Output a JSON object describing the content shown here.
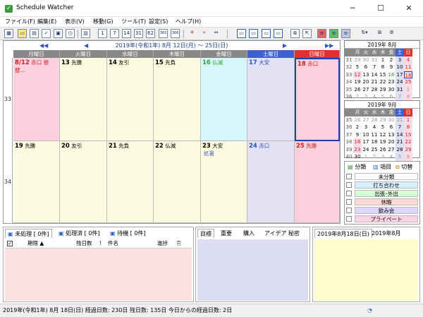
{
  "window": {
    "title": "Schedule Watcher",
    "minimize": "─",
    "maximize": "☐",
    "close": "✕"
  },
  "menu": [
    "ファイル(F)",
    "編集(E)",
    "表示(V)",
    "移動(G)",
    "ツール(T)",
    "設定(S)",
    "ヘルプ(H)"
  ],
  "toolbar": {
    "icons": [
      "grid-icon",
      "folder-icon",
      "note-icon",
      "check-icon",
      "screen-icon",
      "clock-icon",
      "day-1-icon",
      "week-7-icon",
      "twoweek-14-icon",
      "month-31-icon",
      "twomonth-62-icon",
      "year-365-icon",
      "year-366-icon",
      "split-icon",
      "split2-icon",
      "move-icon",
      "layout1-icon",
      "layout2-icon",
      "layout3-icon",
      "layout4-icon",
      "export-icon",
      "import-icon",
      "color-icon",
      "color2-icon",
      "color3-icon",
      "sort-icon",
      "config-icon",
      "gear-icon"
    ],
    "labels": [
      "1",
      "7",
      "14",
      "31",
      "62",
      "365",
      "366"
    ]
  },
  "calendar": {
    "range": "2019年(令和1年) 8月 12日(月) ～ 25日(日)",
    "days": [
      "月曜日",
      "火曜日",
      "水曜日",
      "木曜日",
      "金曜日",
      "土曜日",
      "日曜日"
    ],
    "weeks": [
      {
        "no": "33",
        "cells": [
          {
            "date": "8/12",
            "label": "赤口 振替...",
            "note": ""
          },
          {
            "date": "13",
            "label": "先勝",
            "note": ""
          },
          {
            "date": "14",
            "label": "友引",
            "note": ""
          },
          {
            "date": "15",
            "label": "先負",
            "note": ""
          },
          {
            "date": "16",
            "label": "仏滅",
            "note": ""
          },
          {
            "date": "17",
            "label": "大安",
            "note": ""
          },
          {
            "date": "18",
            "label": "赤口",
            "note": ""
          }
        ]
      },
      {
        "no": "34",
        "cells": [
          {
            "date": "19",
            "label": "先勝",
            "note": ""
          },
          {
            "date": "20",
            "label": "友引",
            "note": ""
          },
          {
            "date": "21",
            "label": "先負",
            "note": ""
          },
          {
            "date": "22",
            "label": "仏滅",
            "note": ""
          },
          {
            "date": "23",
            "label": "大安",
            "note": "処暑"
          },
          {
            "date": "24",
            "label": "赤口",
            "note": ""
          },
          {
            "date": "25",
            "label": "先勝",
            "note": ""
          }
        ]
      }
    ]
  },
  "mini_aug": {
    "title": "2019年 8月",
    "head": [
      "",
      "月",
      "火",
      "水",
      "木",
      "金",
      "土",
      "日"
    ],
    "rows": [
      [
        "31",
        "29",
        "30",
        "31",
        "1",
        "2",
        "3",
        "4"
      ],
      [
        "32",
        "5",
        "6",
        "7",
        "8",
        "9",
        "10",
        "11"
      ],
      [
        "33",
        "12",
        "13",
        "14",
        "15",
        "16",
        "17",
        "18"
      ],
      [
        "34",
        "19",
        "20",
        "21",
        "22",
        "23",
        "24",
        "25"
      ],
      [
        "35",
        "26",
        "27",
        "28",
        "29",
        "30",
        "31",
        "1"
      ],
      [
        "36",
        "2",
        "3",
        "4",
        "5",
        "6",
        "7",
        "8"
      ]
    ]
  },
  "mini_sep": {
    "title": "2019年 9月",
    "head": [
      "",
      "月",
      "火",
      "水",
      "木",
      "金",
      "土",
      "日"
    ],
    "rows": [
      [
        "35",
        "26",
        "27",
        "28",
        "29",
        "30",
        "31",
        "1"
      ],
      [
        "36",
        "2",
        "3",
        "4",
        "5",
        "6",
        "7",
        "8"
      ],
      [
        "37",
        "9",
        "10",
        "11",
        "12",
        "13",
        "14",
        "15"
      ],
      [
        "38",
        "16",
        "17",
        "18",
        "19",
        "20",
        "21",
        "22"
      ],
      [
        "39",
        "23",
        "24",
        "25",
        "26",
        "27",
        "28",
        "29"
      ],
      [
        "40",
        "30",
        "1",
        "2",
        "3",
        "4",
        "5",
        "6"
      ]
    ]
  },
  "categories": {
    "tabs": [
      "分類",
      "項目",
      "切替"
    ],
    "items": [
      {
        "label": "未分類",
        "color": "#ffffff"
      },
      {
        "label": "打ち合わせ",
        "color": "#d8f0ff"
      },
      {
        "label": "出張･外出",
        "color": "#d8ffd8"
      },
      {
        "label": "休暇",
        "color": "#ffd8d8"
      },
      {
        "label": "飲み会",
        "color": "#dcd8ff"
      },
      {
        "label": "プライベート",
        "color": "#ffd0e8"
      }
    ]
  },
  "todo": {
    "tabs": [
      "未処理 [ 0件]",
      "処理済 [ 0件]",
      "待機 [ 0件]"
    ],
    "columns": [
      "",
      "期限 ▲",
      "残日数",
      "!",
      "件名",
      "進捗",
      ""
    ]
  },
  "memo": {
    "tabs": [
      "目標",
      "重要",
      "購入",
      "アイデア",
      "秘密"
    ]
  },
  "daynote": {
    "tabs": [
      "2019年8月18日(日)",
      "2019年8月"
    ]
  },
  "status": "2019年(令和1年) 8月 18日(日) 経過日数: 230日 残日数: 135日 今日からの経過日数: 2日"
}
